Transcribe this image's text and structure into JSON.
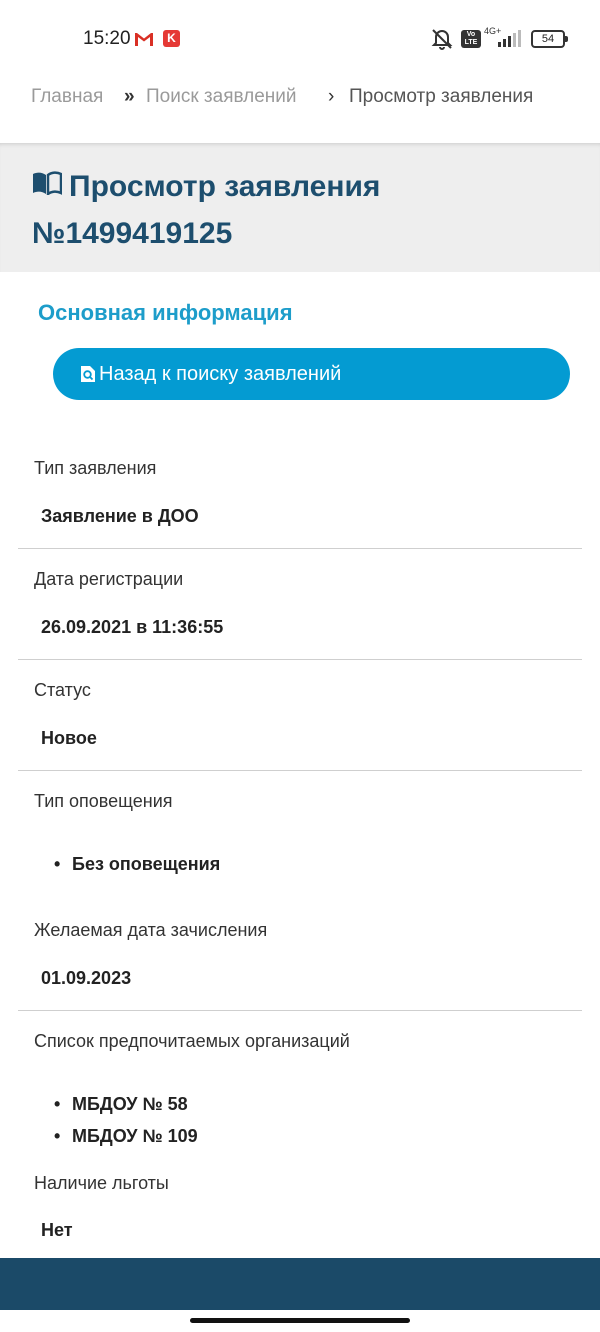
{
  "status_bar": {
    "time": "15:20",
    "network_label": "4G+",
    "volte_label": "Vo LTE",
    "k_badge": "K",
    "battery": "54"
  },
  "breadcrumb": {
    "home": "Главная",
    "sep1": "»",
    "search": "Поиск заявлений",
    "sep2": "›",
    "current": "Просмотр заявления"
  },
  "page": {
    "title": "Просмотр заявления №1499419125",
    "section_title": "Основная информация",
    "back_button_label": "Назад к поиску заявлений"
  },
  "fields": {
    "application_type": {
      "label": "Тип заявления",
      "value": "Заявление в ДОО"
    },
    "registration_date": {
      "label": "Дата регистрации",
      "value": "26.09.2021 в 11:36:55"
    },
    "status": {
      "label": "Статус",
      "value": "Новое"
    },
    "notification_type": {
      "label": "Тип оповещения",
      "items": [
        "Без оповещения"
      ]
    },
    "desired_enrollment_date": {
      "label": "Желаемая дата зачисления",
      "value": "01.09.2023"
    },
    "preferred_organizations": {
      "label": "Список предпочитаемых организаций",
      "items": [
        "МБДОУ № 58",
        "МБДОУ № 109"
      ]
    },
    "benefit": {
      "label": "Наличие льготы",
      "value": "Нет"
    }
  },
  "colors": {
    "accent": "#049bd2",
    "title": "#1d4e6e",
    "section_title": "#1d9dca",
    "footer": "#1b4a68"
  },
  "icons": {
    "title_icon": "open-book-icon",
    "back_icon": "search-document-icon"
  }
}
